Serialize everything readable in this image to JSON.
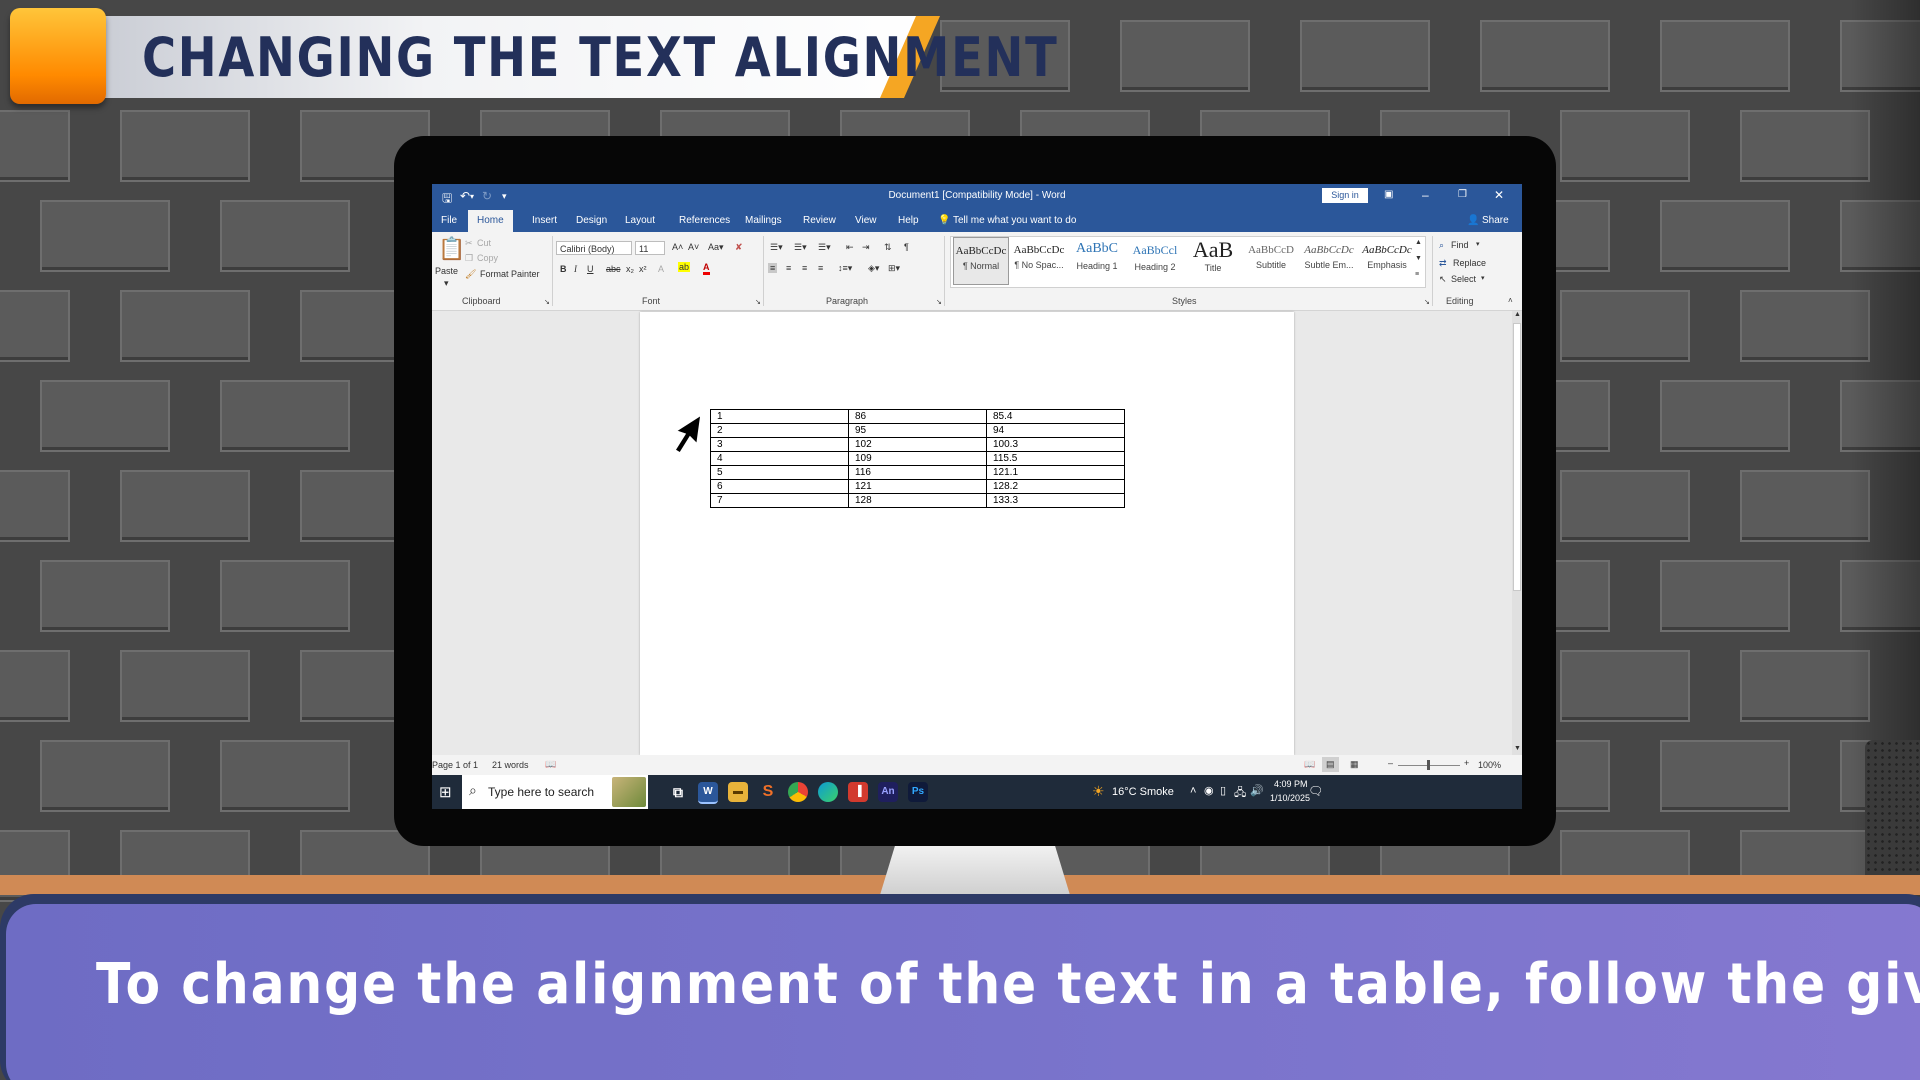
{
  "title": "CHANGING THE TEXT ALIGNMENT",
  "caption": "To change the alignment of the text in a table, follow the given steps:",
  "word": {
    "doc_title": "Document1 [Compatibility Mode]  -  Word",
    "sign_in": "Sign in",
    "tabs": [
      "File",
      "Home",
      "Insert",
      "Design",
      "Layout",
      "References",
      "Mailings",
      "Review",
      "View",
      "Help"
    ],
    "tell_me": "Tell me what you want to do",
    "share": "Share",
    "clipboard": {
      "paste": "Paste",
      "cut": "Cut",
      "copy": "Copy",
      "format_painter": "Format Painter",
      "label": "Clipboard"
    },
    "font": {
      "name": "Calibri (Body)",
      "size": "11",
      "label": "Font"
    },
    "paragraph": {
      "label": "Paragraph"
    },
    "styles": {
      "label": "Styles",
      "items": [
        {
          "preview": "AaBbCcDc",
          "name": "¶ Normal"
        },
        {
          "preview": "AaBbCcDc",
          "name": "¶ No Spac..."
        },
        {
          "preview": "AaBbC",
          "name": "Heading 1"
        },
        {
          "preview": "AaBbCcl",
          "name": "Heading 2"
        },
        {
          "preview": "AaB",
          "name": "Title"
        },
        {
          "preview": "AaBbCcD",
          "name": "Subtitle"
        },
        {
          "preview": "AaBbCcDc",
          "name": "Subtle Em..."
        },
        {
          "preview": "AaBbCcDc",
          "name": "Emphasis"
        }
      ]
    },
    "editing": {
      "find": "Find",
      "replace": "Replace",
      "select": "Select",
      "label": "Editing"
    },
    "table": [
      [
        "1",
        "86",
        "85.4"
      ],
      [
        "2",
        "95",
        "94"
      ],
      [
        "3",
        "102",
        "100.3"
      ],
      [
        "4",
        "109",
        "115.5"
      ],
      [
        "5",
        "116",
        "121.1"
      ],
      [
        "6",
        "121",
        "128.2"
      ],
      [
        "7",
        "128",
        "133.3"
      ]
    ],
    "status": {
      "page": "Page 1 of 1",
      "words": "21 words",
      "zoom": "100%"
    }
  },
  "taskbar": {
    "search_placeholder": "Type here to search",
    "weather": "16°C  Smoke",
    "time": "4:09 PM",
    "date": "1/10/2025"
  },
  "colors": {
    "word_blue": "#2b579a",
    "caption_purple": "#7a74cc",
    "title_navy": "#23305a",
    "accent_orange": "#f5a623"
  }
}
